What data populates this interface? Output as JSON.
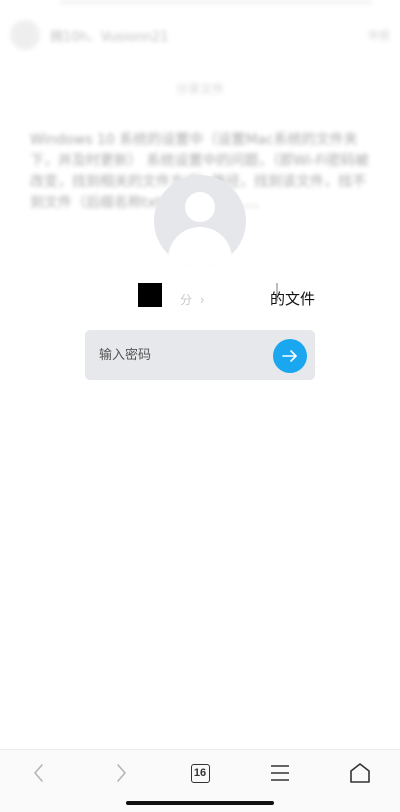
{
  "background": {
    "username": "拥10h、Vusionn21",
    "report_label": "举报",
    "section_title": "分享文件",
    "description": "Windows 10 系统的设置中（设置Mac系统的文件夹下，并及时更新） 系统设置中的问题，（即Wi-Fi密码被改变，找到相关的文件方式）路径，找到该文件，找不到文件（后缀名称txt的文件）后……"
  },
  "share": {
    "owner_faint": "分 ›",
    "owner_suffix": "的文件",
    "password_placeholder": "输入密码"
  },
  "bottom_nav": {
    "tab_count": "16"
  },
  "icons": [
    "avatar-placeholder-icon",
    "arrow-right-icon",
    "back-icon",
    "forward-icon",
    "tabs-icon",
    "menu-icon",
    "home-icon"
  ],
  "colors": {
    "accent": "#1aa7f0",
    "input_bg": "#e6e8eb",
    "avatar_bg": "#e6e7ea"
  }
}
